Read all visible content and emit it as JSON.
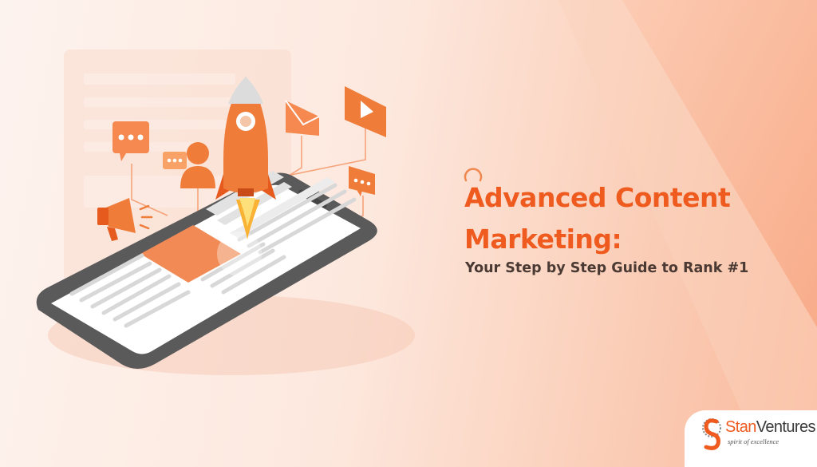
{
  "title": {
    "line1": "Advanced Content",
    "line2": "Marketing:",
    "subtitle": "Your Step by Step Guide to Rank #1"
  },
  "logo": {
    "brand_part1": "Stan",
    "brand_part2": "Ventures",
    "tagline": "spirit of excellence",
    "icon": "stanventures-s-mark"
  },
  "illustration": {
    "icons": [
      "rocket-icon",
      "smartphone-icon",
      "chat-bubble-icon",
      "user-icon",
      "megaphone-icon",
      "email-icon",
      "video-play-icon"
    ]
  },
  "colors": {
    "accent": "#ef5a1f",
    "orange_light": "#f7a26d",
    "text_dark": "#4a3a33",
    "phone_frame": "#555555",
    "background": "#fde8de"
  }
}
